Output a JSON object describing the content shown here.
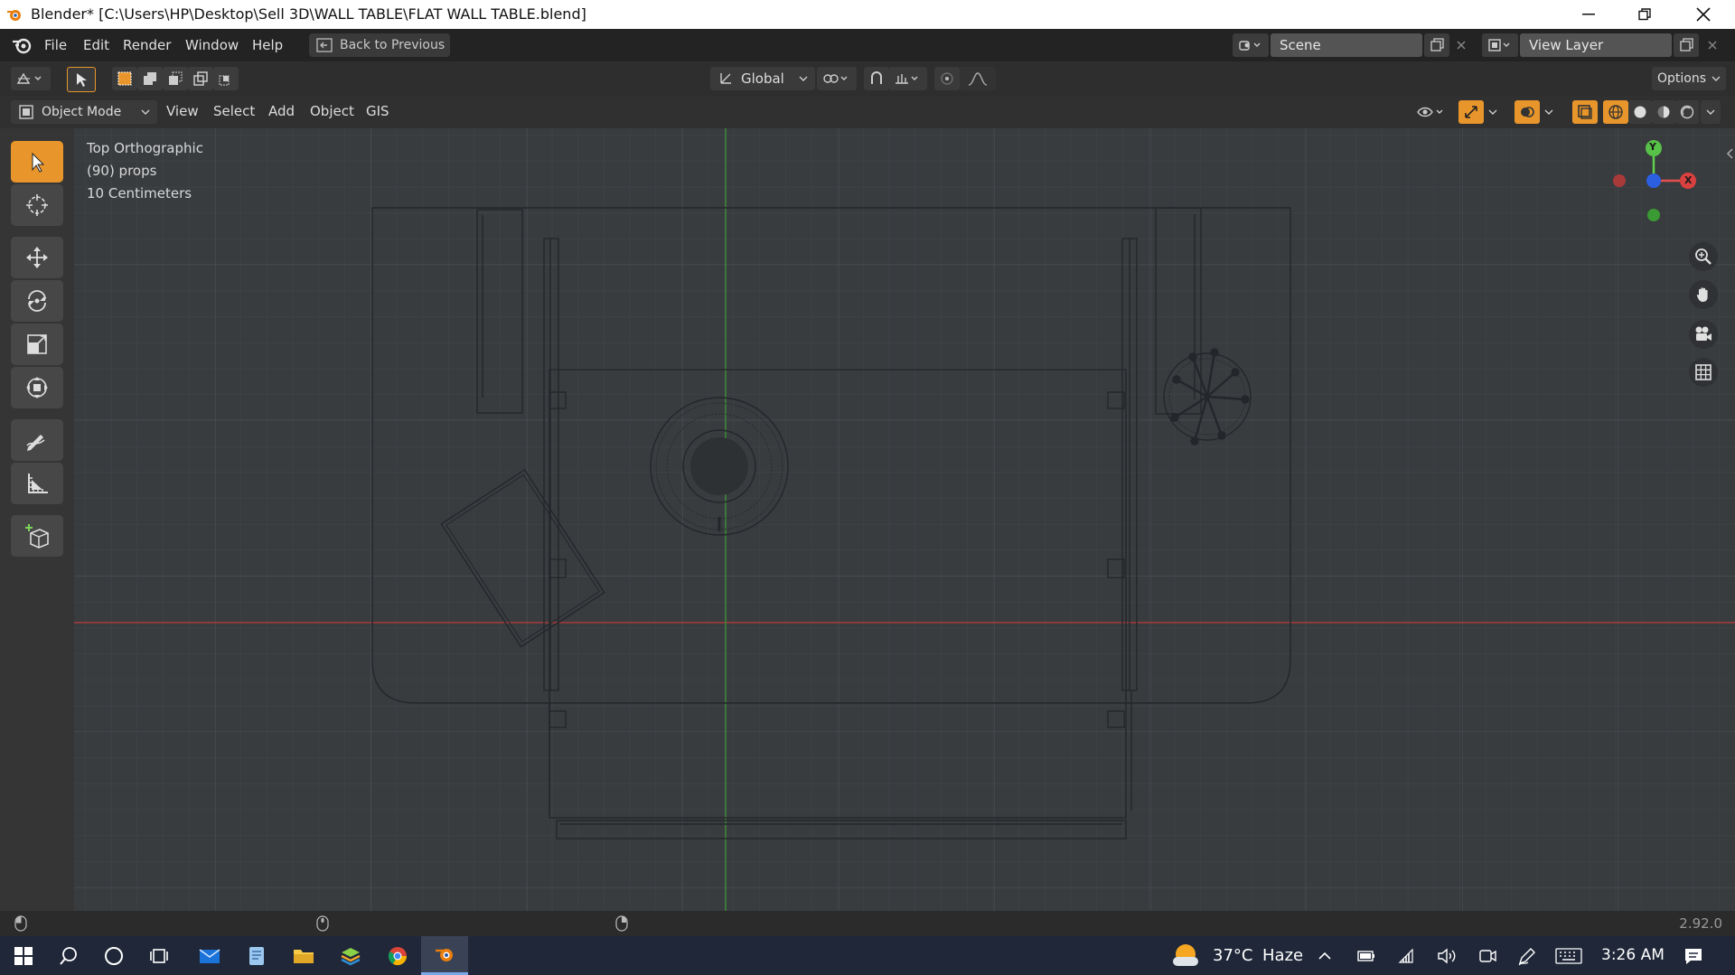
{
  "window": {
    "title": "Blender* [C:\\Users\\HP\\Desktop\\Sell 3D\\WALL TABLE\\FLAT WALL TABLE.blend]"
  },
  "topbar": {
    "menus": [
      "File",
      "Edit",
      "Render",
      "Window",
      "Help"
    ],
    "back_to_previous": "Back to Previous",
    "scene_name": "Scene",
    "view_layer_name": "View Layer"
  },
  "toolheader": {
    "orientation": "Global",
    "options": "Options"
  },
  "modeheader": {
    "mode": "Object Mode",
    "menus": [
      "View",
      "Select",
      "Add",
      "Object",
      "GIS"
    ]
  },
  "viewport": {
    "view_name": "Top Orthographic",
    "collection": "(90) props",
    "grid_scale": "10 Centimeters",
    "gizmo": {
      "y": "Y",
      "x": "X"
    }
  },
  "statusbar": {
    "version": "2.92.0"
  },
  "taskbar": {
    "temperature": "37°C",
    "weather": "Haze",
    "time": "3:26 AM"
  },
  "colors": {
    "accent": "#e8962b",
    "x_axis": "#c23a3a",
    "y_axis": "#37a33a",
    "taskbar": "#1f2738"
  }
}
